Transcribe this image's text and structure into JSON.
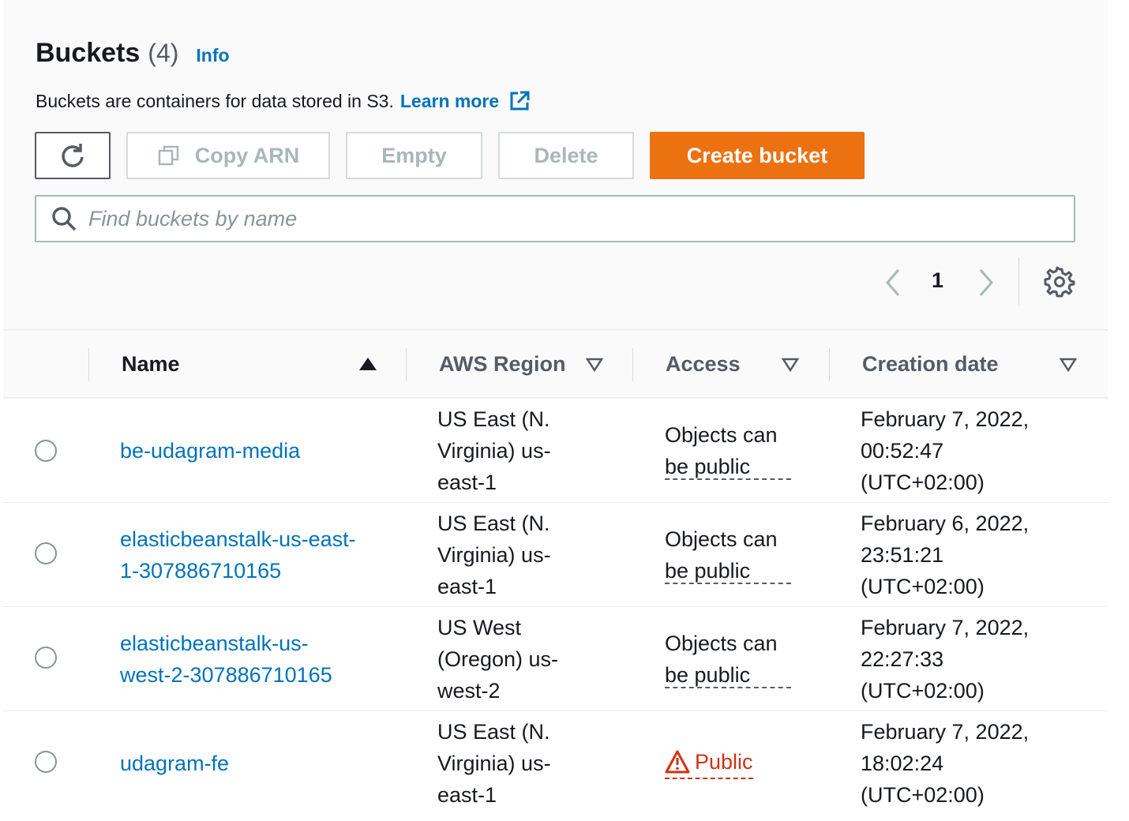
{
  "header": {
    "title": "Buckets",
    "count": "(4)",
    "info": "Info",
    "description": "Buckets are containers for data stored in S3.",
    "learn_more": "Learn more"
  },
  "toolbar": {
    "copy_arn": "Copy ARN",
    "empty": "Empty",
    "delete": "Delete",
    "create": "Create bucket"
  },
  "search": {
    "placeholder": "Find buckets by name"
  },
  "pagination": {
    "current_page": "1"
  },
  "table": {
    "columns": {
      "name": "Name",
      "region": "AWS Region",
      "access": "Access",
      "date": "Creation date"
    },
    "rows": [
      {
        "name_l1": "be-udagram-media",
        "name_l2": "",
        "region_l1": "US East (N.",
        "region_l2": "Virginia) us-",
        "region_l3": "east-1",
        "access_l1": "Objects can",
        "access_l2": "be public",
        "date_l1": "February 7, 2022,",
        "date_l2": "00:52:47",
        "date_l3": "(UTC+02:00)"
      },
      {
        "name_l1": "elasticbeanstalk-us-east-",
        "name_l2": "1-307886710165",
        "region_l1": "US East (N.",
        "region_l2": "Virginia) us-",
        "region_l3": "east-1",
        "access_l1": "Objects can",
        "access_l2": "be public",
        "date_l1": "February 6, 2022,",
        "date_l2": "23:51:21",
        "date_l3": "(UTC+02:00)"
      },
      {
        "name_l1": "elasticbeanstalk-us-",
        "name_l2": "west-2-307886710165",
        "region_l1": "US West",
        "region_l2": "(Oregon) us-",
        "region_l3": "west-2",
        "access_l1": "Objects can",
        "access_l2": "be public",
        "date_l1": "February 7, 2022,",
        "date_l2": "22:27:33",
        "date_l3": "(UTC+02:00)"
      },
      {
        "name_l1": "udagram-fe",
        "name_l2": "",
        "region_l1": "US East (N.",
        "region_l2": "Virginia) us-",
        "region_l3": "east-1",
        "access_public": "Public",
        "date_l1": "February 7, 2022,",
        "date_l2": "18:02:24",
        "date_l3": "(UTC+02:00)"
      }
    ]
  },
  "colors": {
    "link": "#0073bb",
    "primary": "#ec7211",
    "danger": "#d13212",
    "text": "#16191f"
  },
  "icons": [
    "refresh-icon",
    "copy-icon",
    "external-link-icon",
    "search-icon",
    "chevron-left-icon",
    "chevron-right-icon",
    "gear-icon",
    "sort-ascending-icon",
    "sort-descending-icon",
    "warning-icon"
  ]
}
